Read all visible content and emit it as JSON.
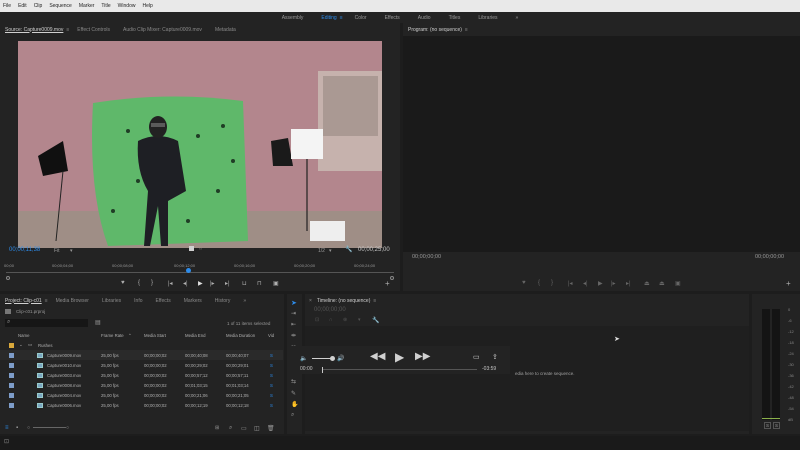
{
  "menu": [
    "File",
    "Edit",
    "Clip",
    "Sequence",
    "Marker",
    "Title",
    "Window",
    "Help"
  ],
  "workspaces": [
    {
      "label": "Assembly",
      "active": false
    },
    {
      "label": "Editing",
      "active": true
    },
    {
      "label": "Color",
      "active": false
    },
    {
      "label": "Effects",
      "active": false
    },
    {
      "label": "Audio",
      "active": false
    },
    {
      "label": "Titles",
      "active": false
    },
    {
      "label": "Libraries",
      "active": false
    }
  ],
  "workspace_more": "»",
  "source_panel": {
    "tabs": [
      "Source: Capture0009.mov",
      "Effect Controls",
      "Audio Clip Mixer: Capture0009.mov",
      "Metadata"
    ],
    "tab_menu": "≡",
    "timecode_in": "00;00;11;38",
    "zoom": "Fit",
    "fraction": "1/2",
    "timecode_dur": "00;00;25;00",
    "ruler": [
      "00;00",
      "00;00;04;00",
      "00;00;08;00",
      "00;00;12;00",
      "00;00;16;00",
      "00;00;20;00",
      "00;00;24;00"
    ],
    "playhead_fraction": 0.47
  },
  "program_panel": {
    "title": "Program: (no sequence)",
    "tab_menu": "≡",
    "timecode_left": "00;00;00;00",
    "timecode_right": "00;00;00;00"
  },
  "project_panel": {
    "tabs": [
      "Project: Clip-c01",
      "Media Browser",
      "Libraries",
      "Info",
      "Effects",
      "Markers",
      "History"
    ],
    "tab_menu": "≡",
    "more": "»",
    "file": "Clip-c01.prproj",
    "selection": "1 of 11 items selected",
    "columns": [
      "Name",
      "Frame Rate",
      "Media Start",
      "Media End",
      "Media Duration",
      "Vid"
    ],
    "bin": "Rushes",
    "rows": [
      {
        "name": "Capture0009.mov",
        "rate": "25,00 fps",
        "start": "00;00;00;02",
        "end": "00;00;40;08",
        "dur": "00;00;40;07"
      },
      {
        "name": "Capture0010.mov",
        "rate": "25,00 fps",
        "start": "00;00;00;02",
        "end": "00;00;29;02",
        "dur": "00;00;29;01"
      },
      {
        "name": "Capture0003.mov",
        "rate": "25,00 fps",
        "start": "00;00;00;02",
        "end": "00;00;57;12",
        "dur": "00;00;57;11"
      },
      {
        "name": "Capture0008.mov",
        "rate": "25,00 fps",
        "start": "00;00;00;02",
        "end": "00;01;03;15",
        "dur": "00;01;03;14"
      },
      {
        "name": "Capture0004.mov",
        "rate": "25,00 fps",
        "start": "00;00;00;02",
        "end": "00;00;21;06",
        "dur": "00;00;21;05"
      },
      {
        "name": "Capture0006.mov",
        "rate": "25,00 fps",
        "start": "00;00;00;02",
        "end": "00;00;12;19",
        "dur": "00;00;12;18"
      }
    ],
    "row_marker": "S"
  },
  "timeline_panel": {
    "title": "Timeline: (no sequence)",
    "tab_menu": "≡",
    "timecode": "00;00;00;00",
    "drop_hint": "edia here to create sequence.",
    "audio_start": "00:00",
    "audio_end": "-03:59"
  },
  "meter": {
    "scale": [
      "0",
      "-6",
      "-12",
      "-18",
      "-24",
      "-30",
      "-36",
      "-42",
      "-48",
      "-54",
      "dB"
    ],
    "solo": [
      "S",
      "S"
    ]
  },
  "colors": {
    "accent": "#2d8ceb",
    "panel": "#232323",
    "background": "#1d1d1d"
  }
}
